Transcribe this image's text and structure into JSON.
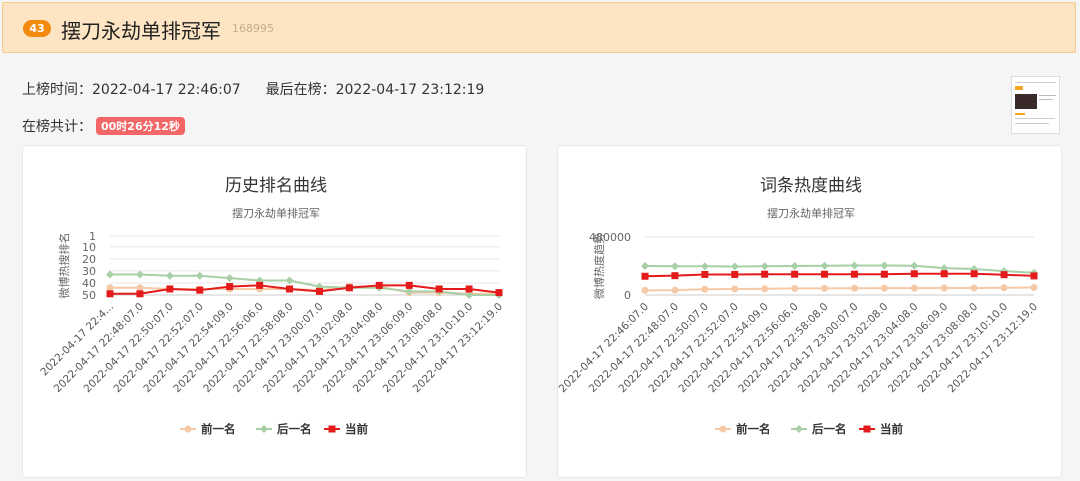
{
  "header": {
    "rank_badge": "43",
    "title": "摆刀永劫单排冠军",
    "count": "168995"
  },
  "info": {
    "on_time_label": "上榜时间：",
    "on_time": "2022-04-17 22:46:07",
    "last_label": "最后在榜：",
    "last_time": "2022-04-17 23:12:19",
    "total_label": "在榜共计：",
    "duration": "00时26分12秒"
  },
  "colors": {
    "prev": "#f5c8a6",
    "next": "#a9cfa7",
    "current": "#e41b1b"
  },
  "chart_data": [
    {
      "type": "line",
      "title": "历史排名曲线",
      "subtitle": "摆刀永劫单排冠军",
      "ylabel": "微博热搜排名",
      "y_inverted": true,
      "ylim": [
        1,
        50
      ],
      "y_ticks": [
        "1",
        "10",
        "20",
        "30",
        "40",
        "50"
      ],
      "categories": [
        "2022-04-17 22:4...",
        "2022-04-17 22:48:07.0",
        "2022-04-17 22:50:07.0",
        "2022-04-17 22:52:07.0",
        "2022-04-17 22:54:09.0",
        "2022-04-17 22:56:06.0",
        "2022-04-17 22:58:08.0",
        "2022-04-17 23:00:07.0",
        "2022-04-17 23:02:08.0",
        "2022-04-17 23:04:08.0",
        "2022-04-17 23:06:09.0",
        "2022-04-17 23:08:08.0",
        "2022-04-17 23:10:10.0",
        "2022-04-17 23:12:19.0"
      ],
      "series": [
        {
          "name": "前一名",
          "color": "#f5c8a6",
          "values": [
            44,
            44,
            45,
            45,
            45,
            45,
            45,
            46,
            43,
            43,
            48,
            48,
            49,
            49
          ]
        },
        {
          "name": "后一名",
          "color": "#a9cfa7",
          "values": [
            33,
            33,
            34,
            34,
            36,
            38,
            38,
            43,
            44,
            44,
            47,
            47,
            50,
            50
          ]
        },
        {
          "name": "当前",
          "color": "#e41b1b",
          "values": [
            49,
            49,
            45,
            46,
            43,
            42,
            45,
            47,
            44,
            42,
            42,
            45,
            45,
            48
          ]
        }
      ]
    },
    {
      "type": "line",
      "title": "词条热度曲线",
      "subtitle": "摆刀永劫单排冠军",
      "ylabel": "微博热度趋势",
      "ylim": [
        0,
        480000
      ],
      "y_ticks": [
        "0",
        "480000"
      ],
      "categories": [
        "2022-04-17 22:46:07.0",
        "2022-04-17 22:48:07.0",
        "2022-04-17 22:50:07.0",
        "2022-04-17 22:52:07.0",
        "2022-04-17 22:54:09.0",
        "2022-04-17 22:56:06.0",
        "2022-04-17 22:58:08.0",
        "2022-04-17 23:00:07.0",
        "2022-04-17 23:02:08.0",
        "2022-04-17 23:04:08.0",
        "2022-04-17 23:06:09.0",
        "2022-04-17 23:08:08.0",
        "2022-04-17 23:10:10.0",
        "2022-04-17 23:12:19.0"
      ],
      "series": [
        {
          "name": "前一名",
          "color": "#f5c8a6",
          "values": [
            38000,
            40000,
            48000,
            50000,
            52000,
            55000,
            55000,
            56000,
            57000,
            57000,
            58000,
            58000,
            60000,
            62000
          ]
        },
        {
          "name": "后一名",
          "color": "#a9cfa7",
          "values": [
            240000,
            238000,
            238000,
            236000,
            238000,
            240000,
            242000,
            244000,
            244000,
            242000,
            222000,
            215000,
            198000,
            184000
          ]
        },
        {
          "name": "当前",
          "color": "#e41b1b",
          "values": [
            155000,
            160000,
            170000,
            170000,
            172000,
            172000,
            172000,
            172000,
            172000,
            176000,
            176000,
            176000,
            168000,
            158000
          ]
        }
      ]
    }
  ]
}
